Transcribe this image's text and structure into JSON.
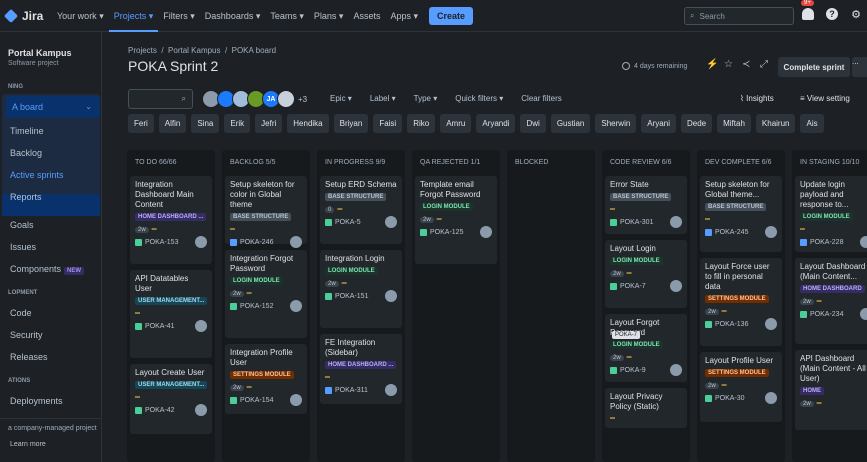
{
  "topnav": {
    "logo": "Jira",
    "items": [
      "Your work",
      "Projects",
      "Filters",
      "Dashboards",
      "Teams",
      "Plans",
      "Assets",
      "Apps"
    ],
    "create": "Create",
    "search_placeholder": "Search",
    "notif_badge": "9+",
    "help": "?"
  },
  "sidebar": {
    "project_name": "Portal Kampus",
    "project_type": "Software project",
    "planning_head": "NING",
    "board": "A board",
    "items": [
      "Timeline",
      "Backlog",
      "Active sprints",
      "Reports"
    ],
    "goals": "Goals",
    "issues": "Issues",
    "components": "Components",
    "new_badge": "NEW",
    "dev_head": "LOPMENT",
    "dev_items": [
      "Code",
      "Security",
      "Releases"
    ],
    "ops_head": "ATIONS",
    "deployments": "Deployments",
    "footer": "a company-managed project",
    "learn": "Learn more"
  },
  "header": {
    "breadcrumb": [
      "Projects",
      "Portal Kampus",
      "POKA board"
    ],
    "title": "POKA Sprint 2",
    "remaining": "4 days remaining",
    "complete": "Complete sprint",
    "more": "..."
  },
  "filters": {
    "avatar_initials": "JA",
    "more_count": "+3",
    "dropdowns": [
      "Epic",
      "Label",
      "Type",
      "Quick filters"
    ],
    "clear": "Clear filters",
    "insights": "Insights",
    "view": "View setting"
  },
  "chips": [
    "Feri",
    "Alfin",
    "Sina",
    "Erik",
    "Jefri",
    "Hendika",
    "Briyan",
    "Faisi",
    "Riko",
    "Amru",
    "Aryandi",
    "Dwi",
    "Gustian",
    "Sherwin",
    "Aryani",
    "Dede",
    "Miftah",
    "Khairun",
    "Ais"
  ],
  "columns": [
    {
      "title": "TO DO 66/66",
      "cards": [
        {
          "title": "Integration Dashboard Main Content",
          "epic": "HOME DASHBOARD ...",
          "epic_bg": "#352c63",
          "epic_fg": "#b8acf6",
          "est": "2w",
          "key": "POKA-153",
          "type": "story"
        },
        {
          "title": "API Datatables User",
          "epic": "USER MANAGEMENT...",
          "epic_bg": "#164555",
          "epic_fg": "#9dd9ee",
          "est": "",
          "key": "POKA-41",
          "type": "story"
        },
        {
          "title": "Layout Create User",
          "epic": "USER MANAGEMENT...",
          "epic_bg": "#164555",
          "epic_fg": "#9dd9ee",
          "est": "",
          "key": "POKA-42",
          "type": "story"
        }
      ]
    },
    {
      "title": "BACKLOG 5/5",
      "cards": [
        {
          "title": "Setup skeleton for color in Global theme",
          "epic": "BASE STRUCTURE",
          "epic_bg": "#454f59",
          "epic_fg": "#b6c2cf",
          "est": "",
          "key": "POKA-246",
          "type": "task"
        },
        {
          "title": "Integration Forgot Password",
          "epic": "LOGIN MODULE",
          "epic_bg": "#1c3329",
          "epic_fg": "#7ee2b8",
          "est": "2w",
          "key": "POKA-152",
          "type": "story"
        },
        {
          "title": "Integration Profile User",
          "epic": "SETTINGS MODULE",
          "epic_bg": "#702e00",
          "epic_fg": "#fec195",
          "est": "2w",
          "key": "POKA-154",
          "type": "story"
        }
      ]
    },
    {
      "title": "IN PROGRESS 9/9",
      "cards": [
        {
          "title": "Setup ERD Schema",
          "epic": "BASE STRUCTURE",
          "epic_bg": "#454f59",
          "epic_fg": "#b6c2cf",
          "est": "0",
          "key": "POKA-5",
          "type": "story"
        },
        {
          "title": "Integration Login",
          "epic": "LOGIN MODULE",
          "epic_bg": "#1c3329",
          "epic_fg": "#7ee2b8",
          "est": "2w",
          "key": "POKA-151",
          "type": "story"
        },
        {
          "title": "FE Integration (Sidebar)",
          "epic": "HOME DASHBOARD ...",
          "epic_bg": "#352c63",
          "epic_fg": "#b8acf6",
          "est": "",
          "key": "POKA-311",
          "type": "task"
        }
      ]
    },
    {
      "title": "QA REJECTED 1/1",
      "cards": [
        {
          "title": "Template email Forgot Password",
          "epic": "LOGIN MODULE",
          "epic_bg": "#1c3329",
          "epic_fg": "#7ee2b8",
          "est": "2w",
          "key": "POKA-125",
          "type": "story"
        }
      ]
    },
    {
      "title": "BLOCKED",
      "cards": []
    },
    {
      "title": "CODE REVIEW 6/6",
      "cards": [
        {
          "title": "Error State",
          "epic": "BASE STRUCTURE",
          "epic_bg": "#454f59",
          "epic_fg": "#b6c2cf",
          "est": "",
          "key": "POKA-301",
          "type": "story"
        },
        {
          "title": "Layout Login",
          "epic": "LOGIN MODULE",
          "epic_bg": "#1c3329",
          "epic_fg": "#7ee2b8",
          "est": "2w",
          "key": "POKA-7",
          "type": "story"
        },
        {
          "title": "Layout Forgot Password",
          "epic": "LOGIN MODULE",
          "epic_bg": "#1c3329",
          "epic_fg": "#7ee2b8",
          "est": "2w",
          "key": "POKA-9",
          "type": "story"
        },
        {
          "title": "Layout Privacy Policy (Static)",
          "epic": "",
          "epic_bg": "",
          "epic_fg": "",
          "est": "",
          "key": "",
          "type": "story"
        }
      ]
    },
    {
      "title": "DEV COMPLETE 6/6",
      "cards": [
        {
          "title": "Setup skeleton for Global theme...",
          "epic": "BASE STRUCTURE",
          "epic_bg": "#454f59",
          "epic_fg": "#b6c2cf",
          "est": "",
          "key": "POKA-245",
          "type": "task"
        },
        {
          "title": "Layout Force user to fill in personal data",
          "epic": "SETTINGS MODULE",
          "epic_bg": "#702e00",
          "epic_fg": "#fec195",
          "est": "2w",
          "key": "POKA-136",
          "type": "story"
        },
        {
          "title": "Layout Profile User",
          "epic": "SETTINGS MODULE",
          "epic_bg": "#702e00",
          "epic_fg": "#fec195",
          "est": "2w",
          "key": "POKA-30",
          "type": "story"
        }
      ]
    },
    {
      "title": "IN STAGING 10/10",
      "cards": [
        {
          "title": "Update login payload and response to...",
          "epic": "LOGIN MODULE",
          "epic_bg": "#1c3329",
          "epic_fg": "#7ee2b8",
          "est": "",
          "key": "POKA-228",
          "type": "task"
        },
        {
          "title": "Layout Dashboard (Main Content...",
          "epic": "HOME DASHBOARD",
          "epic_bg": "#352c63",
          "epic_fg": "#b8acf6",
          "est": "2w",
          "key": "POKA-234",
          "type": "story"
        },
        {
          "title": "API Dashboard (Main Content - All User)",
          "epic": "HOME",
          "epic_bg": "#352c63",
          "epic_fg": "#b8acf6",
          "est": "2w",
          "key": "",
          "type": "story"
        }
      ]
    }
  ],
  "tooltip": "POKA-7"
}
